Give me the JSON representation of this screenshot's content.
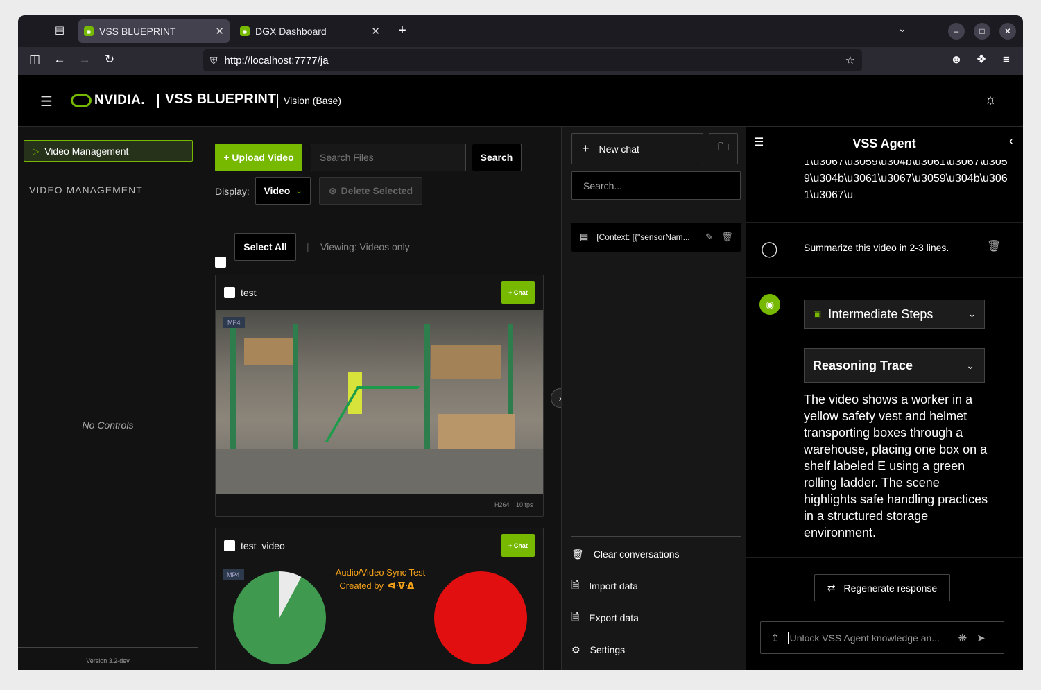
{
  "browser": {
    "tabs": [
      {
        "label": "VSS BLUEPRINT",
        "active": true
      },
      {
        "label": "DGX Dashboard",
        "active": false
      }
    ],
    "url": "http://localhost:7777/ja"
  },
  "header": {
    "brand": "NVIDIA.",
    "title": "VSS BLUEPRINT",
    "subtitle": "Vision (Base)"
  },
  "sidebar": {
    "button": "Video Management",
    "section": "VIDEO MANAGEMENT",
    "empty": "No Controls",
    "version": "Version 3.2-dev"
  },
  "toolbar": {
    "upload": "+ Upload Video",
    "search_placeholder": "Search Files",
    "search": "Search",
    "display_label": "Display:",
    "display_value": "Video",
    "delete": "Delete Selected",
    "select_all": "Select All",
    "viewing": "Viewing: Videos only"
  },
  "videos": [
    {
      "name": "test",
      "format": "MP4",
      "codec": "H264",
      "fps": "10 fps",
      "chat": "+ Chat"
    },
    {
      "name": "test_video",
      "format": "MP4",
      "chat": "+ Chat",
      "overlay_title": "Audio/Video Sync Test",
      "overlay_sub": "Created by"
    }
  ],
  "chats": {
    "new_chat": "New chat",
    "search_placeholder": "Search...",
    "items": [
      "[Context: [{\"sensorNam..."
    ],
    "menu": [
      "Clear conversations",
      "Import data",
      "Export data",
      "Settings"
    ]
  },
  "agent": {
    "title": "VSS Agent",
    "overflow_text": "1\\u3067\\u3059\\u304b\\u3061\\u3067\\u3059\\u304b\\u3061\\u3067\\u3059\\u304b\\u3061\\u3067\\u",
    "user_msg": "Summarize this video in 2-3 lines.",
    "steps": "Intermediate Steps",
    "trace": "Reasoning Trace",
    "response": "The video shows a worker in a yellow safety vest and helmet transporting boxes through a warehouse, placing one box on a shelf labeled E using a green rolling ladder. The scene highlights safe handling practices in a structured storage environment.",
    "regenerate": "Regenerate response",
    "input_placeholder": "Unlock VSS Agent knowledge an..."
  }
}
